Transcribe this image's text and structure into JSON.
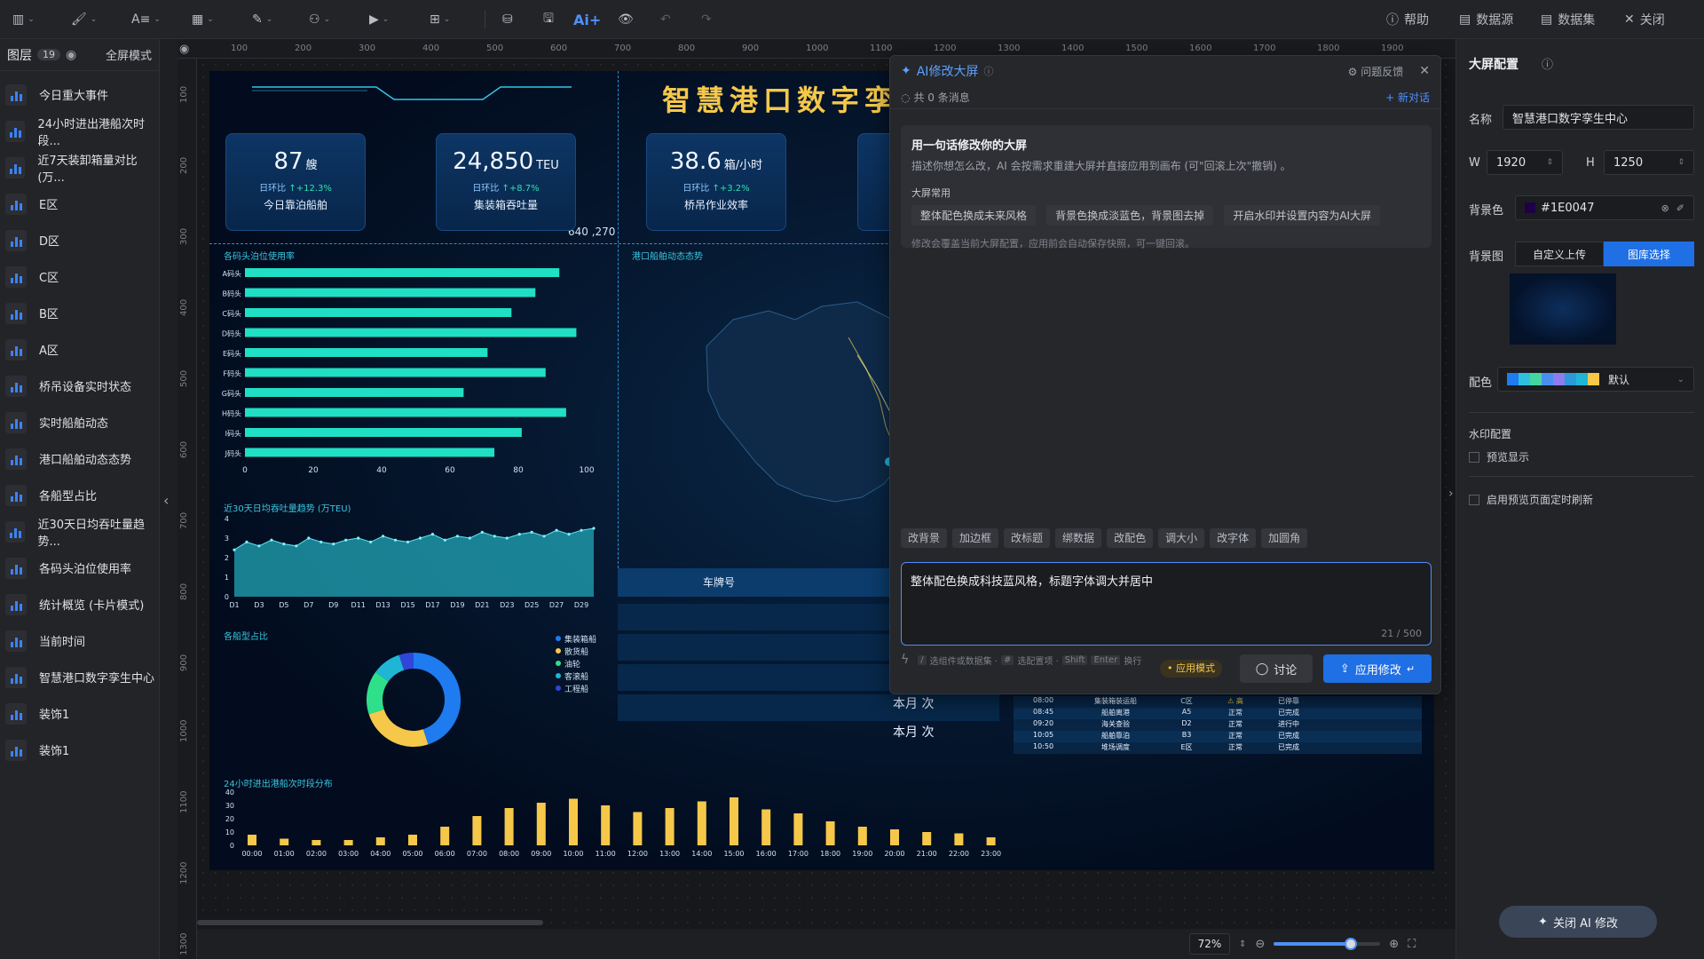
{
  "toolbar": {
    "help": "帮助",
    "datasource": "数据源",
    "dataset": "数据集",
    "close": "关闭",
    "ai_label": "Ai+"
  },
  "layers": {
    "title": "图层",
    "count": "19",
    "fullscreen": "全屏模式",
    "items": [
      "今日重大事件",
      "24小时进出港船次时段...",
      "近7天装卸箱量对比 (万...",
      "E区",
      "D区",
      "C区",
      "B区",
      "A区",
      "桥吊设备实时状态",
      "实时船舶动态",
      "港口船舶动态态势",
      "各船型占比",
      "近30天日均吞吐量趋势...",
      "各码头泊位使用率",
      "统计概览 (卡片模式)",
      "当前时间",
      "智慧港口数字孪生中心",
      "装饰1",
      "装饰1"
    ]
  },
  "ruler": {
    "top": [
      "100",
      "200",
      "300",
      "400",
      "500",
      "600",
      "700",
      "800",
      "900",
      "1000",
      "1100",
      "1200",
      "1300",
      "1400",
      "1500",
      "1600",
      "1700",
      "1800",
      "1900"
    ],
    "left": [
      "100",
      "200",
      "300",
      "400",
      "500",
      "600",
      "700",
      "800",
      "900",
      "1000",
      "1100",
      "1200",
      "1300"
    ]
  },
  "screen": {
    "title": "智慧港口数字孪",
    "coord": "640 ,270",
    "cards": [
      {
        "value": "87",
        "unit": "艘",
        "change_label": "日环比",
        "change": "↑+12.3%",
        "label": "今日靠泊船舶"
      },
      {
        "value": "24,850",
        "unit": "TEU",
        "change_label": "日环比",
        "change": "↑+8.7%",
        "label": "集装箱吞吐量"
      },
      {
        "value": "38.6",
        "unit": "箱/小时",
        "change_label": "日环比",
        "change": "↑+3.2%",
        "label": "桥吊作业效率"
      }
    ],
    "berth_title": "各码头泊位使用率",
    "map_title": "港口船舶动态态势",
    "trend_title": "近30天日均吞吐量趋势 (万TEU)",
    "donut_title": "各船型占比",
    "hours_title": "24小时进出港船次时段分布",
    "plate_header": "车牌号",
    "week_rows": [
      "本月 次",
      "本月 次"
    ],
    "legend": [
      "集装箱船",
      "散货船",
      "油轮",
      "客滚船",
      "工程船"
    ],
    "legend_colors": [
      "#1e7bf0",
      "#f5c84a",
      "#2fe08a",
      "#1fb6d6",
      "#3046d8"
    ],
    "ship_table": [
      {
        "time": "08:00",
        "name": "集装箱装运船",
        "area": "C区",
        "status": "⚠ 高",
        "state": "已停靠"
      },
      {
        "time": "08:45",
        "name": "船舶离港",
        "area": "A5",
        "status": "正常",
        "state": "已完成"
      },
      {
        "time": "09:20",
        "name": "海关查验",
        "area": "D2",
        "status": "正常",
        "state": "进行中"
      },
      {
        "time": "10:05",
        "name": "船舶靠泊",
        "area": "B3",
        "status": "正常",
        "state": "已完成"
      },
      {
        "time": "10:50",
        "name": "堆场调度",
        "area": "E区",
        "status": "正常",
        "state": "已完成"
      }
    ]
  },
  "chart_data": [
    {
      "type": "bar",
      "orientation": "horizontal",
      "title": "各码头泊位使用率",
      "categories": [
        "A码头",
        "B码头",
        "C码头",
        "D码头",
        "E码头",
        "F码头",
        "G码头",
        "H码头",
        "I码头",
        "J码头"
      ],
      "values": [
        92,
        85,
        78,
        97,
        71,
        88,
        64,
        94,
        81,
        73
      ],
      "xlim": [
        0,
        100
      ],
      "ticks": [
        "0",
        "20",
        "40",
        "60",
        "80",
        "100"
      ],
      "color": "#1fe0c4"
    },
    {
      "type": "area",
      "title": "近30天日均吞吐量趋势 (万TEU)",
      "x": [
        "D1",
        "D2",
        "D3",
        "D4",
        "D5",
        "D6",
        "D7",
        "D8",
        "D9",
        "D10",
        "D11",
        "D12",
        "D13",
        "D14",
        "D15",
        "D16",
        "D17",
        "D18",
        "D19",
        "D20",
        "D21",
        "D22",
        "D23",
        "D24",
        "D25",
        "D26",
        "D27",
        "D28",
        "D29",
        "D30"
      ],
      "values": [
        2.4,
        2.8,
        2.6,
        2.9,
        2.7,
        2.6,
        3.0,
        2.8,
        2.7,
        2.9,
        3.0,
        2.8,
        3.1,
        2.9,
        2.8,
        3.0,
        3.2,
        2.9,
        3.1,
        3.0,
        3.3,
        3.1,
        3.0,
        3.2,
        3.3,
        3.1,
        3.4,
        3.2,
        3.4,
        3.5
      ],
      "xticks": [
        "D1",
        "D3",
        "D5",
        "D7",
        "D9",
        "D11",
        "D13",
        "D15",
        "D17",
        "D19",
        "D21",
        "D23",
        "D25",
        "D27",
        "D29"
      ],
      "ylim": [
        0,
        4
      ],
      "yticks": [
        "0",
        "1",
        "2",
        "3",
        "4"
      ],
      "color": "#21a7b8"
    },
    {
      "type": "pie",
      "title": "各船型占比",
      "categories": [
        "集装箱船",
        "散货船",
        "油轮",
        "客滚船",
        "工程船"
      ],
      "values": [
        45,
        25,
        15,
        10,
        5
      ]
    },
    {
      "type": "bar",
      "title": "24小时进出港船次时段分布",
      "categories": [
        "00:00",
        "01:00",
        "02:00",
        "03:00",
        "04:00",
        "05:00",
        "06:00",
        "07:00",
        "08:00",
        "09:00",
        "10:00",
        "11:00",
        "12:00",
        "13:00",
        "14:00",
        "15:00",
        "16:00",
        "17:00",
        "18:00",
        "19:00",
        "20:00",
        "21:00",
        "22:00",
        "23:00"
      ],
      "values": [
        8,
        5,
        4,
        4,
        6,
        8,
        14,
        22,
        28,
        32,
        35,
        30,
        25,
        28,
        33,
        36,
        27,
        24,
        18,
        14,
        12,
        10,
        9,
        6
      ],
      "ylim": [
        0,
        40
      ],
      "yticks": [
        "0",
        "10",
        "20",
        "30",
        "40"
      ],
      "color": "#f5c84a"
    }
  ],
  "ai_panel": {
    "title": "AI修改大屏",
    "feedback": "问题反馈",
    "msg_count": "共 0 条消息",
    "new_chat": "+ 新对话",
    "intro_title": "用一句话修改你的大屏",
    "intro_desc": "描述你想怎么改，AI 会按需求重建大屏并直接应用到画布 (可\"回滚上次\"撤销) 。",
    "examples_title": "大屏常用",
    "examples": [
      "整体配色换成未来风格",
      "背景色换成淡蓝色，背景图去掉",
      "开启水印并设置内容为AI大屏"
    ],
    "intro_note": "修改会覆盖当前大屏配置，应用前会自动保存快照，可一键回滚。",
    "quick_chips": [
      "改背景",
      "加边框",
      "改标题",
      "绑数据",
      "改配色",
      "调大小",
      "改字体",
      "加圆角"
    ],
    "input_value": "整体配色换成科技蓝风格，标题字体调大并居中",
    "counter": "21 / 500",
    "hint_1": "选组件或数据集 ·",
    "hint_2": "选配置项 ·",
    "hint_3": "换行",
    "hint_key_slash": "/",
    "hint_key_hash": "#",
    "hint_key_shift": "Shift",
    "hint_key_enter": "Enter",
    "mode_badge": "应用模式",
    "discuss": "讨论",
    "apply": "应用修改"
  },
  "props": {
    "title": "大屏配置",
    "name_label": "名称",
    "name_value": "智慧港口数字孪生中心",
    "w_label": "W",
    "w_value": "1920",
    "h_label": "H",
    "h_value": "1250",
    "bg_color_label": "背景色",
    "bg_color_value": "#1E0047",
    "bg_img_label": "背景图",
    "upload": "自定义上传",
    "gallery": "图库选择",
    "palette_label": "配色",
    "palette_value": "默认",
    "palette_colors": [
      "#1e7bf0",
      "#2fc0e0",
      "#43d6a0",
      "#4a8ff0",
      "#8e7bf0",
      "#2b9ad8",
      "#1fb6d6",
      "#f5c84a"
    ],
    "watermark_title": "水印配置",
    "watermark_preview": "预览显示",
    "refresh": "启用预览页面定时刷新",
    "close_ai": "关闭 AI 修改"
  },
  "zoom": {
    "value": "72%"
  }
}
